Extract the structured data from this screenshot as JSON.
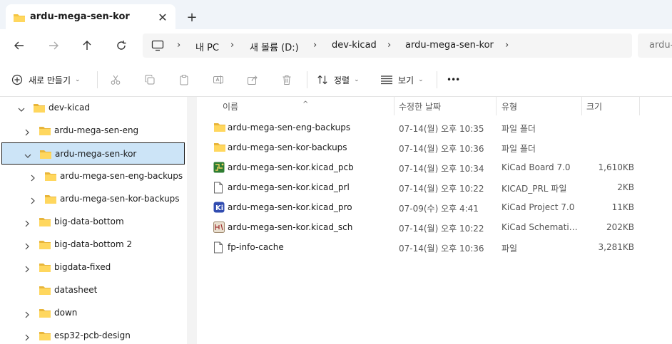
{
  "tab": {
    "title": "ardu-mega-sen-kor",
    "close": "✕",
    "new_tab": "+"
  },
  "nav": {
    "back": "←",
    "forward": "→",
    "up": "↑",
    "refresh": "↻",
    "breadcrumb": [
      "내 PC",
      "새 볼륨 (D:)",
      "dev-kicad",
      "ardu-mega-sen-kor"
    ],
    "separator": "›",
    "search_placeholder": "ardu-m"
  },
  "toolbar": {
    "new_label": "새로 만들기",
    "sort_label": "정렬",
    "view_label": "보기",
    "more": "•••",
    "icons": [
      "cut-icon",
      "copy-icon",
      "paste-icon",
      "rename-icon",
      "share-icon",
      "delete-icon"
    ]
  },
  "tree": [
    {
      "label": "dev-kicad",
      "expanded": true,
      "level": 0
    },
    {
      "label": "ardu-mega-sen-eng",
      "expanded": false,
      "level": 1
    },
    {
      "label": "ardu-mega-sen-kor",
      "expanded": true,
      "level": 1,
      "selected": true
    },
    {
      "label": "ardu-mega-sen-eng-backups",
      "expanded": false,
      "level": 2
    },
    {
      "label": "ardu-mega-sen-kor-backups",
      "expanded": false,
      "level": 2
    },
    {
      "label": "big-data-bottom",
      "expanded": false,
      "level": 1
    },
    {
      "label": "big-data-bottom 2",
      "expanded": false,
      "level": 1
    },
    {
      "label": "bigdata-fixed",
      "expanded": false,
      "level": 1
    },
    {
      "label": "datasheet",
      "expanded": null,
      "level": 1
    },
    {
      "label": "down",
      "expanded": false,
      "level": 1
    },
    {
      "label": "esp32-pcb-design",
      "expanded": false,
      "level": 1
    }
  ],
  "columns": {
    "name": "이름",
    "date": "수정한 날짜",
    "type": "유형",
    "size": "크기",
    "sort_indicator": "^"
  },
  "files": [
    {
      "name": "ardu-mega-sen-eng-backups",
      "date": "07-14(월) 오후 10:35",
      "type": "파일 폴더",
      "size": "",
      "icon": "folder-icon"
    },
    {
      "name": "ardu-mega-sen-kor-backups",
      "date": "07-14(월) 오후 10:36",
      "type": "파일 폴더",
      "size": "",
      "icon": "folder-icon"
    },
    {
      "name": "ardu-mega-sen-kor.kicad_pcb",
      "date": "07-14(월) 오후 10:34",
      "type": "KiCad Board 7.0",
      "size": "1,610KB",
      "icon": "kicad-pcb-icon"
    },
    {
      "name": "ardu-mega-sen-kor.kicad_prl",
      "date": "07-14(월) 오후 10:22",
      "type": "KICAD_PRL 파일",
      "size": "2KB",
      "icon": "file-icon"
    },
    {
      "name": "ardu-mega-sen-kor.kicad_pro",
      "date": "07-09(수) 오후 4:41",
      "type": "KiCad Project 7.0",
      "size": "11KB",
      "icon": "kicad-pro-icon"
    },
    {
      "name": "ardu-mega-sen-kor.kicad_sch",
      "date": "07-14(월) 오후 10:22",
      "type": "KiCad Schematic ...",
      "size": "202KB",
      "icon": "kicad-sch-icon"
    },
    {
      "name": "fp-info-cache",
      "date": "07-14(월) 오후 10:36",
      "type": "파일",
      "size": "3,281KB",
      "icon": "file-icon"
    }
  ]
}
